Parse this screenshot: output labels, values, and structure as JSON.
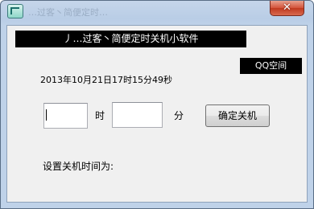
{
  "window": {
    "title": "…过客丶简便定时…",
    "close_icon_glyph": "✕"
  },
  "app": {
    "banner_text": "丿…过客丶简便定时关机小软件",
    "qq_button_label": "QQ空间",
    "current_datetime": "2013年10月21日17时15分49秒",
    "hour_value": "",
    "minute_value": "",
    "hour_unit": "时",
    "minute_unit": "分",
    "shutdown_button_label": "确定关机",
    "status_label": "设置关机时间为:"
  },
  "colors": {
    "banner_bg": "#000000",
    "banner_text": "#ffffff",
    "close_button": "#c73b22",
    "window_frame": "#b9cde6"
  }
}
